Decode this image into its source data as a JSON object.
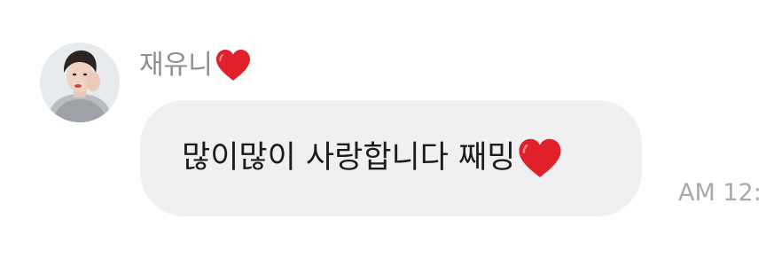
{
  "message": {
    "sender_name": "재유니",
    "sender_heart_icon": "red-heart-icon",
    "text": "많이많이 사랑합니다 째밍",
    "text_heart_icon": "red-heart-icon",
    "timestamp": "AM 12:"
  },
  "colors": {
    "bubble_background": "#f0f0f3",
    "sender_name": "#8e8e93",
    "message_text": "#1c1c1e",
    "timestamp": "#a9a9ae",
    "heart": "#e0202a"
  }
}
